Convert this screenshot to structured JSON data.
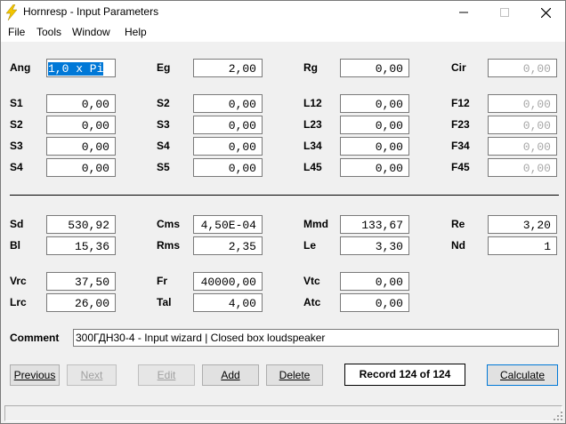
{
  "window": {
    "title": "Hornresp - Input Parameters",
    "minimize_icon": "minimize-icon",
    "maximize_icon": "maximize-icon",
    "close_icon": "close-icon"
  },
  "menu": [
    "File",
    "Tools",
    "Window",
    "Help"
  ],
  "rows": [
    [
      {
        "label": "Ang",
        "value": "1,0 x Pi",
        "state": "selected"
      },
      {
        "label": "Eg",
        "value": "2,00"
      },
      {
        "label": "Rg",
        "value": "0,00"
      },
      {
        "label": "Cir",
        "value": "0,00",
        "state": "disabled"
      }
    ],
    [
      {
        "label": "S1",
        "value": "0,00"
      },
      {
        "label": "S2",
        "value": "0,00"
      },
      {
        "label": "L12",
        "value": "0,00"
      },
      {
        "label": "F12",
        "value": "0,00",
        "state": "disabled"
      }
    ],
    [
      {
        "label": "S2",
        "value": "0,00"
      },
      {
        "label": "S3",
        "value": "0,00"
      },
      {
        "label": "L23",
        "value": "0,00"
      },
      {
        "label": "F23",
        "value": "0,00",
        "state": "disabled"
      }
    ],
    [
      {
        "label": "S3",
        "value": "0,00"
      },
      {
        "label": "S4",
        "value": "0,00"
      },
      {
        "label": "L34",
        "value": "0,00"
      },
      {
        "label": "F34",
        "value": "0,00",
        "state": "disabled"
      }
    ],
    [
      {
        "label": "S4",
        "value": "0,00"
      },
      {
        "label": "S5",
        "value": "0,00"
      },
      {
        "label": "L45",
        "value": "0,00"
      },
      {
        "label": "F45",
        "value": "0,00",
        "state": "disabled"
      }
    ],
    [
      {
        "label": "Sd",
        "value": "530,92"
      },
      {
        "label": "Cms",
        "value": "4,50E-04"
      },
      {
        "label": "Mmd",
        "value": "133,67"
      },
      {
        "label": "Re",
        "value": "3,20"
      }
    ],
    [
      {
        "label": "Bl",
        "value": "15,36"
      },
      {
        "label": "Rms",
        "value": "2,35"
      },
      {
        "label": "Le",
        "value": "3,30"
      },
      {
        "label": "Nd",
        "value": "1"
      }
    ],
    [
      {
        "label": "Vrc",
        "value": "37,50"
      },
      {
        "label": "Fr",
        "value": "40000,00"
      },
      {
        "label": "Vtc",
        "value": "0,00"
      },
      null
    ],
    [
      {
        "label": "Lrc",
        "value": "26,00"
      },
      {
        "label": "Tal",
        "value": "4,00"
      },
      {
        "label": "Atc",
        "value": "0,00"
      },
      null
    ]
  ],
  "comment": {
    "label": "Comment",
    "value": "300ГДН30-4 - Input wizard | Closed box loudspeaker"
  },
  "buttons": {
    "previous": "Previous",
    "next": "Next",
    "edit": "Edit",
    "add": "Add",
    "delete": "Delete",
    "calculate": "Calculate"
  },
  "record": "Record 124 of 124"
}
